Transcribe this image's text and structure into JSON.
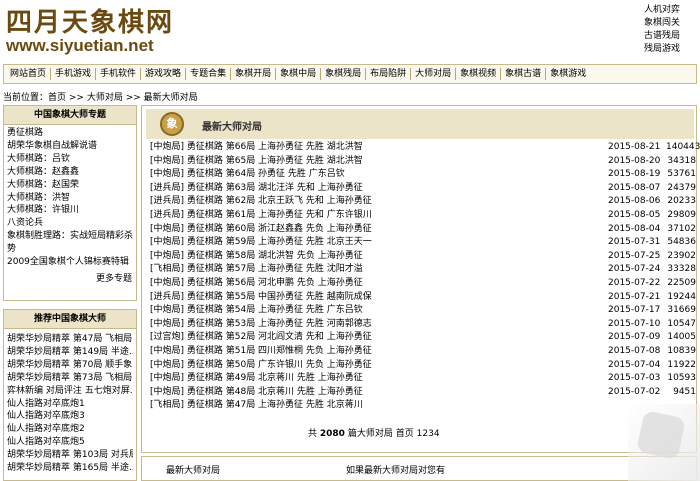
{
  "header": {
    "logo_cn": "四月天象棋网",
    "logo_url": "www.siyuetian.net",
    "top_links": [
      "人机对弈",
      "象棋闯关",
      "古谱残局",
      "残局游戏"
    ]
  },
  "nav": [
    "网站首页",
    "手机游戏",
    "手机软件",
    "游戏攻略",
    "专题合集",
    "象棋开局",
    "象棋中局",
    "象棋残局",
    "布局陷阱",
    "大师对局",
    "象棋视频",
    "象棋古谱",
    "象棋游戏"
  ],
  "breadcrumb": {
    "prefix": "当前位置：",
    "home": "首页",
    "sep1": " >> ",
    "c1": "大师对局",
    "sep2": " >> ",
    "c2": "最新大师对局"
  },
  "side1": {
    "title": "中国象棋大师专题",
    "items": [
      "勇征棋路",
      "胡荣华象棋自战解说谱",
      "大师棋路：吕钦",
      "大师棋路：赵鑫鑫",
      "大师棋路：赵国荣",
      "大师棋路：洪智",
      "大师棋路：许银川",
      "八资论兵",
      "象棋制胜理路：实战短局精彩杀势",
      "2009全国象棋个人锦标赛特辑"
    ],
    "more": "更多专题"
  },
  "side2": {
    "title": "推荐中国象棋大师",
    "items": [
      "胡荣华妙局精萃 第47局 飞相局...",
      "胡荣华妙局精萃 第149局 半途...",
      "胡荣华妙局精萃 第70局 顺手象",
      "胡荣华妙局精萃 第73局 飞相局...",
      "弈林新编 对局评注 五七炮对屏...",
      "仙人指路对卒底炮1",
      "仙人指路对卒底炮3",
      "仙人指路对卒底炮2",
      "仙人指路对卒底炮5",
      "胡荣华妙局精萃 第103局 对兵局",
      "胡荣华妙局精萃 第165局 半途..."
    ]
  },
  "main": {
    "icon": "象",
    "title": "最新大师对局"
  },
  "games": [
    {
      "title": "[中炮局] 勇征棋路 第66局 上海孙勇征 先胜 湖北洪智",
      "date": "2015-08-21",
      "views": "140443"
    },
    {
      "title": "[中炮局] 勇征棋路 第65局 上海孙勇征 先胜 湖北洪智",
      "date": "2015-08-20",
      "views": "34318"
    },
    {
      "title": "[中炮局] 勇征棋路 第64局 孙勇征 先胜 广东吕钦",
      "date": "2015-08-19",
      "views": "53761"
    },
    {
      "title": "[进兵局] 勇征棋路 第63局 湖北汪洋 先和 上海孙勇征",
      "date": "2015-08-07",
      "views": "24379"
    },
    {
      "title": "[进兵局] 勇征棋路 第62局 北京王跃飞 先和 上海孙勇征",
      "date": "2015-08-06",
      "views": "20233"
    },
    {
      "title": "[进兵局] 勇征棋路 第61局 上海孙勇征 先和 广东许银川",
      "date": "2015-08-05",
      "views": "29809"
    },
    {
      "title": "[中炮局] 勇征棋路 第60局 浙江赵鑫鑫 先负 上海孙勇征",
      "date": "2015-08-04",
      "views": "37102"
    },
    {
      "title": "[中炮局] 勇征棋路 第59局 上海孙勇征 先胜 北京王天一",
      "date": "2015-07-31",
      "views": "54836"
    },
    {
      "title": "[中炮局] 勇征棋路 第58局 湖北洪智 先负 上海孙勇征",
      "date": "2015-07-25",
      "views": "23902"
    },
    {
      "title": "[飞相局] 勇征棋路 第57局 上海孙勇征 先胜 沈阳才溢",
      "date": "2015-07-24",
      "views": "33328"
    },
    {
      "title": "[中炮局] 勇征棋路 第56局 河北申鹏 先负 上海孙勇征",
      "date": "2015-07-22",
      "views": "22509"
    },
    {
      "title": "[进兵局] 勇征棋路 第55局 中国孙勇征 先胜 越南阮成保",
      "date": "2015-07-21",
      "views": "19244"
    },
    {
      "title": "[中炮局] 勇征棋路 第54局 上海孙勇征 先胜 广东吕钦",
      "date": "2015-07-17",
      "views": "31669"
    },
    {
      "title": "[中炮局] 勇征棋路 第53局 上海孙勇征 先胜 河南郭德志",
      "date": "2015-07-10",
      "views": "10547"
    },
    {
      "title": "[过宫炮] 勇征棋路 第52局 河北阎文清 先和 上海孙勇征",
      "date": "2015-07-09",
      "views": "14005"
    },
    {
      "title": "[中炮局] 勇征棋路 第51局 四川郑惟桐 先负 上海孙勇征",
      "date": "2015-07-08",
      "views": "10839"
    },
    {
      "title": "[中炮局] 勇征棋路 第50局 广东许银川 先负 上海孙勇征",
      "date": "2015-07-04",
      "views": "11922"
    },
    {
      "title": "[中炮局] 勇征棋路 第49局 北京蒋川 先胜 上海孙勇征",
      "date": "2015-07-03",
      "views": "10593"
    },
    {
      "title": "[中炮局] 勇征棋路 第48局 北京蒋川 先胜 上海孙勇征",
      "date": "2015-07-02",
      "views": "9451"
    },
    {
      "title": "[飞相局] 勇征棋路 第47局 上海孙勇征 先胜 北京蒋川",
      "date": "",
      "views": ""
    }
  ],
  "pager": {
    "prefix": "共",
    "count": "2080",
    "suffix": "篇大师对局",
    "first": "首页",
    "pages": [
      "1",
      "2",
      "3",
      "4"
    ]
  },
  "bottom": {
    "left": "最新大师对局",
    "right": "如果最新大师对局对您有"
  }
}
